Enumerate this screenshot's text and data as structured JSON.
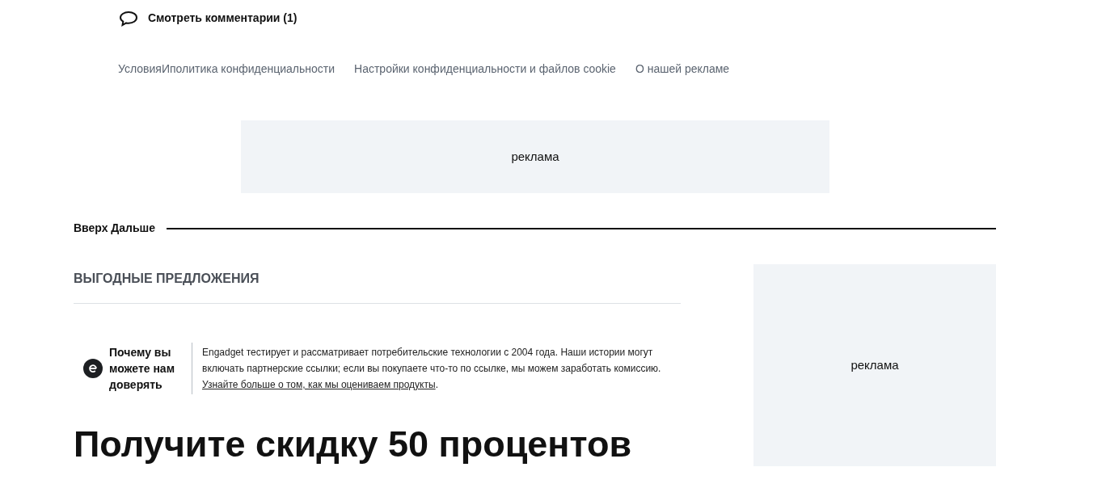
{
  "comments_link": "Смотреть комментарии (1)",
  "footer_links": [
    "УсловияИполитика конфиденциальности",
    "Настройки конфиденциальности и файлов cookie",
    "О нашей рекламе"
  ],
  "ad_top": "реклама",
  "up_next": "Вверх Дальше",
  "section_title": "ВЫГОДНЫЕ ПРЕДЛОЖЕНИЯ",
  "trust": {
    "title": "Почему вы можете нам доверять",
    "text": "Engadget тестирует и рассматривает потребительские технологии с 2004 года. Наши истории могут включать партнерские ссылки; если вы покупаете что-то по ссылке, мы можем заработать комиссию.",
    "link": "Узнайте больше о том, как мы оцениваем продукты",
    "after": "."
  },
  "headline": "Получите скидку 50 процентов",
  "ad_side": "реклама"
}
